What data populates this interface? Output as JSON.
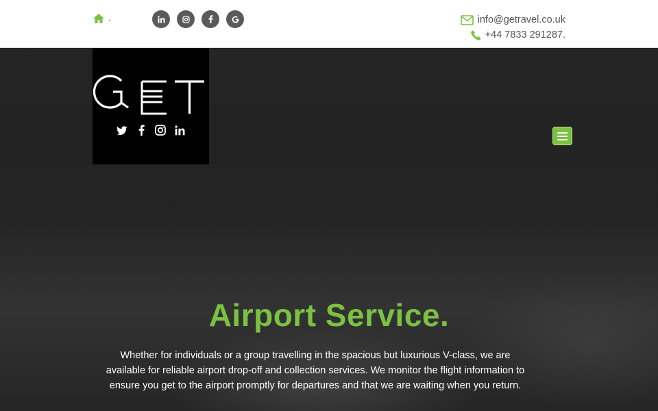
{
  "topbar": {
    "separator": ".",
    "social": [
      "linkedin-icon",
      "instagram-icon",
      "facebook-icon",
      "google-icon"
    ],
    "email": "info@getravel.co.uk",
    "phone": "+44 7833 291287."
  },
  "logo": {
    "text": "GET",
    "social": [
      "twitter-icon",
      "facebook-icon",
      "instagram-icon",
      "linkedin-icon"
    ]
  },
  "hero": {
    "title": "Airport Service.",
    "description": "Whether for individuals or a group travelling in the spacious but luxurious V-class, we are available for reliable airport drop-off and collection services. We monitor the flight information to ensure you get to the airport promptly for departures and that we are waiting when you return."
  },
  "colors": {
    "accent": "#7bc142",
    "dark": "#2b2b2b",
    "social_circle": "#5a5a5a"
  }
}
